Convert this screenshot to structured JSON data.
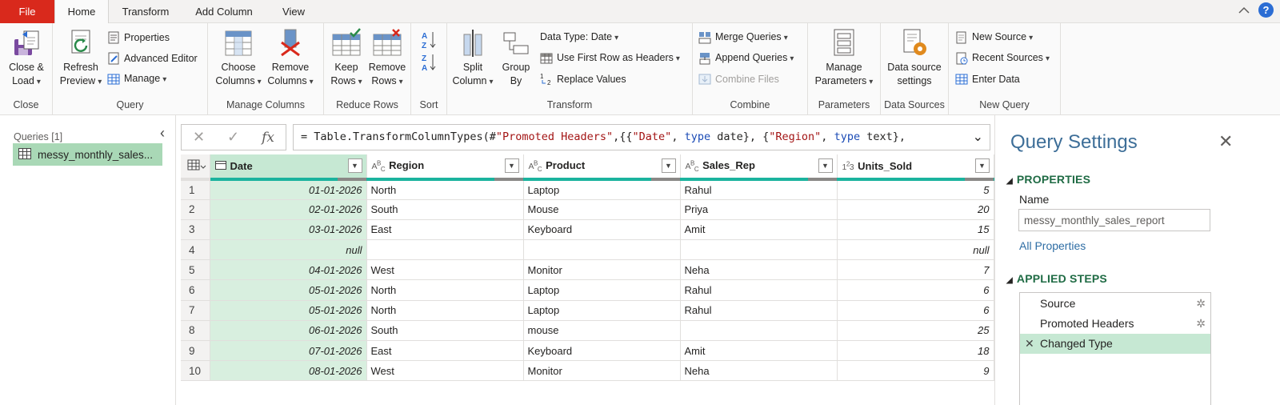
{
  "tabs": [
    "File",
    "Home",
    "Transform",
    "Add Column",
    "View"
  ],
  "help_label": "?",
  "ribbon": {
    "close": {
      "close_load_1": "Close &",
      "close_load_2": "Load",
      "group": "Close"
    },
    "query": {
      "refresh_1": "Refresh",
      "refresh_2": "Preview",
      "properties": "Properties",
      "advanced_editor": "Advanced Editor",
      "manage": "Manage",
      "group": "Query"
    },
    "manage_columns": {
      "choose_1": "Choose",
      "choose_2": "Columns",
      "remove_1": "Remove",
      "remove_2": "Columns",
      "group": "Manage Columns"
    },
    "reduce_rows": {
      "keep_1": "Keep",
      "keep_2": "Rows",
      "remove_1": "Remove",
      "remove_2": "Rows",
      "group": "Reduce Rows"
    },
    "sort": {
      "group": "Sort"
    },
    "transform": {
      "split_1": "Split",
      "split_2": "Column",
      "group_1": "Group",
      "group_2": "By",
      "data_type": "Data Type: Date",
      "first_row": "Use First Row as Headers",
      "replace": "Replace Values",
      "group": "Transform"
    },
    "combine": {
      "merge": "Merge Queries",
      "append": "Append Queries",
      "combine_files": "Combine Files",
      "group": "Combine"
    },
    "parameters": {
      "manage_1": "Manage",
      "manage_2": "Parameters",
      "group": "Parameters"
    },
    "data_sources": {
      "settings_1": "Data source",
      "settings_2": "settings",
      "group": "Data Sources"
    },
    "new_query": {
      "new_source": "New Source",
      "recent_sources": "Recent Sources",
      "enter_data": "Enter Data",
      "group": "New Query"
    }
  },
  "queries": {
    "title": "Queries [1]",
    "items": [
      "messy_monthly_sales..."
    ]
  },
  "formula": {
    "prefix": "= Table.TransformColumnTypes(#",
    "p1": "\"Promoted Headers\"",
    "p2": ",{{",
    "p3": "\"Date\"",
    "p4": ", ",
    "p5": "type",
    "p6": " date}, {",
    "p7": "\"Region\"",
    "p8": ", ",
    "p9": "type",
    "p10": " text},"
  },
  "grid": {
    "columns": [
      {
        "type": "",
        "name": "Date"
      },
      {
        "type": "ABC",
        "name": "Region"
      },
      {
        "type": "ABC",
        "name": "Product"
      },
      {
        "type": "ABC",
        "name": "Sales_Rep"
      },
      {
        "type": "123",
        "name": "Units_Sold"
      }
    ],
    "rows": [
      [
        "1",
        "01-01-2026",
        "North",
        "Laptop",
        "Rahul",
        "5"
      ],
      [
        "2",
        "02-01-2026",
        "South",
        "Mouse",
        "Priya",
        "20"
      ],
      [
        "3",
        "03-01-2026",
        "East",
        "Keyboard",
        "Amit",
        "15"
      ],
      [
        "4",
        "null",
        "",
        "",
        "",
        "null"
      ],
      [
        "5",
        "04-01-2026",
        "West",
        "Monitor",
        "Neha",
        "7"
      ],
      [
        "6",
        "05-01-2026",
        "North",
        "Laptop",
        "Rahul",
        "6"
      ],
      [
        "7",
        "05-01-2026",
        "North",
        "Laptop",
        "Rahul",
        "6"
      ],
      [
        "8",
        "06-01-2026",
        "South",
        "mouse",
        "",
        "25"
      ],
      [
        "9",
        "07-01-2026",
        "East",
        "Keyboard",
        "Amit",
        "18"
      ],
      [
        "10",
        "08-01-2026",
        "West",
        "Monitor",
        "Neha",
        "9"
      ]
    ]
  },
  "settings": {
    "title": "Query Settings",
    "properties_heading": "PROPERTIES",
    "name_label": "Name",
    "name_value": "messy_monthly_sales_report",
    "all_properties": "All Properties",
    "steps_heading": "APPLIED STEPS",
    "steps": [
      "Source",
      "Promoted Headers",
      "Changed Type"
    ]
  },
  "colors": {
    "file_tab": "#d9291c",
    "accent_teal": "#1bb39e",
    "selection_green": "#c6e8d3",
    "settings_title": "#3d6e98",
    "section_green": "#1f6b44"
  }
}
